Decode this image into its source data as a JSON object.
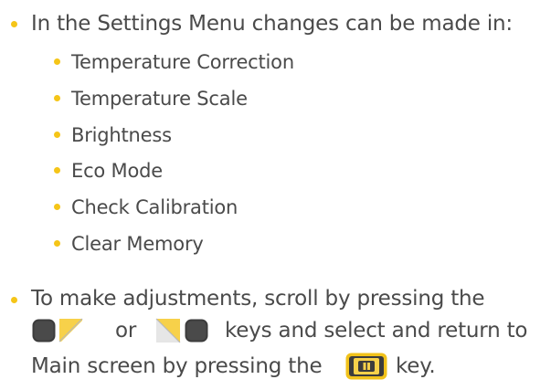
{
  "intro": "In the Settings Menu changes can be made in:",
  "menu_items": [
    "Temperature Correction",
    "Temperature Scale",
    "Brightness",
    "Eco Mode",
    "Check Calibration",
    "Clear Memory"
  ],
  "instructions": {
    "line1": "To make adjustments, scroll by pressing the",
    "or_word": "or",
    "line2_end": "keys and select and return to",
    "line3_start": "Main screen by pressing the",
    "line3_end": "key."
  },
  "icons": {
    "left_keys": "dark-square-with-yellow-left-arrow-icon",
    "right_keys": "yellow-right-arrow-with-dark-square-icon",
    "select_key": "yellow-enter-key-icon"
  },
  "colors": {
    "bullet": "#f5c518",
    "text": "#4a4a4a",
    "key_dark": "#3c3c3c",
    "key_yellow": "#f7d14a",
    "key_yellow_dark": "#e8b400"
  }
}
